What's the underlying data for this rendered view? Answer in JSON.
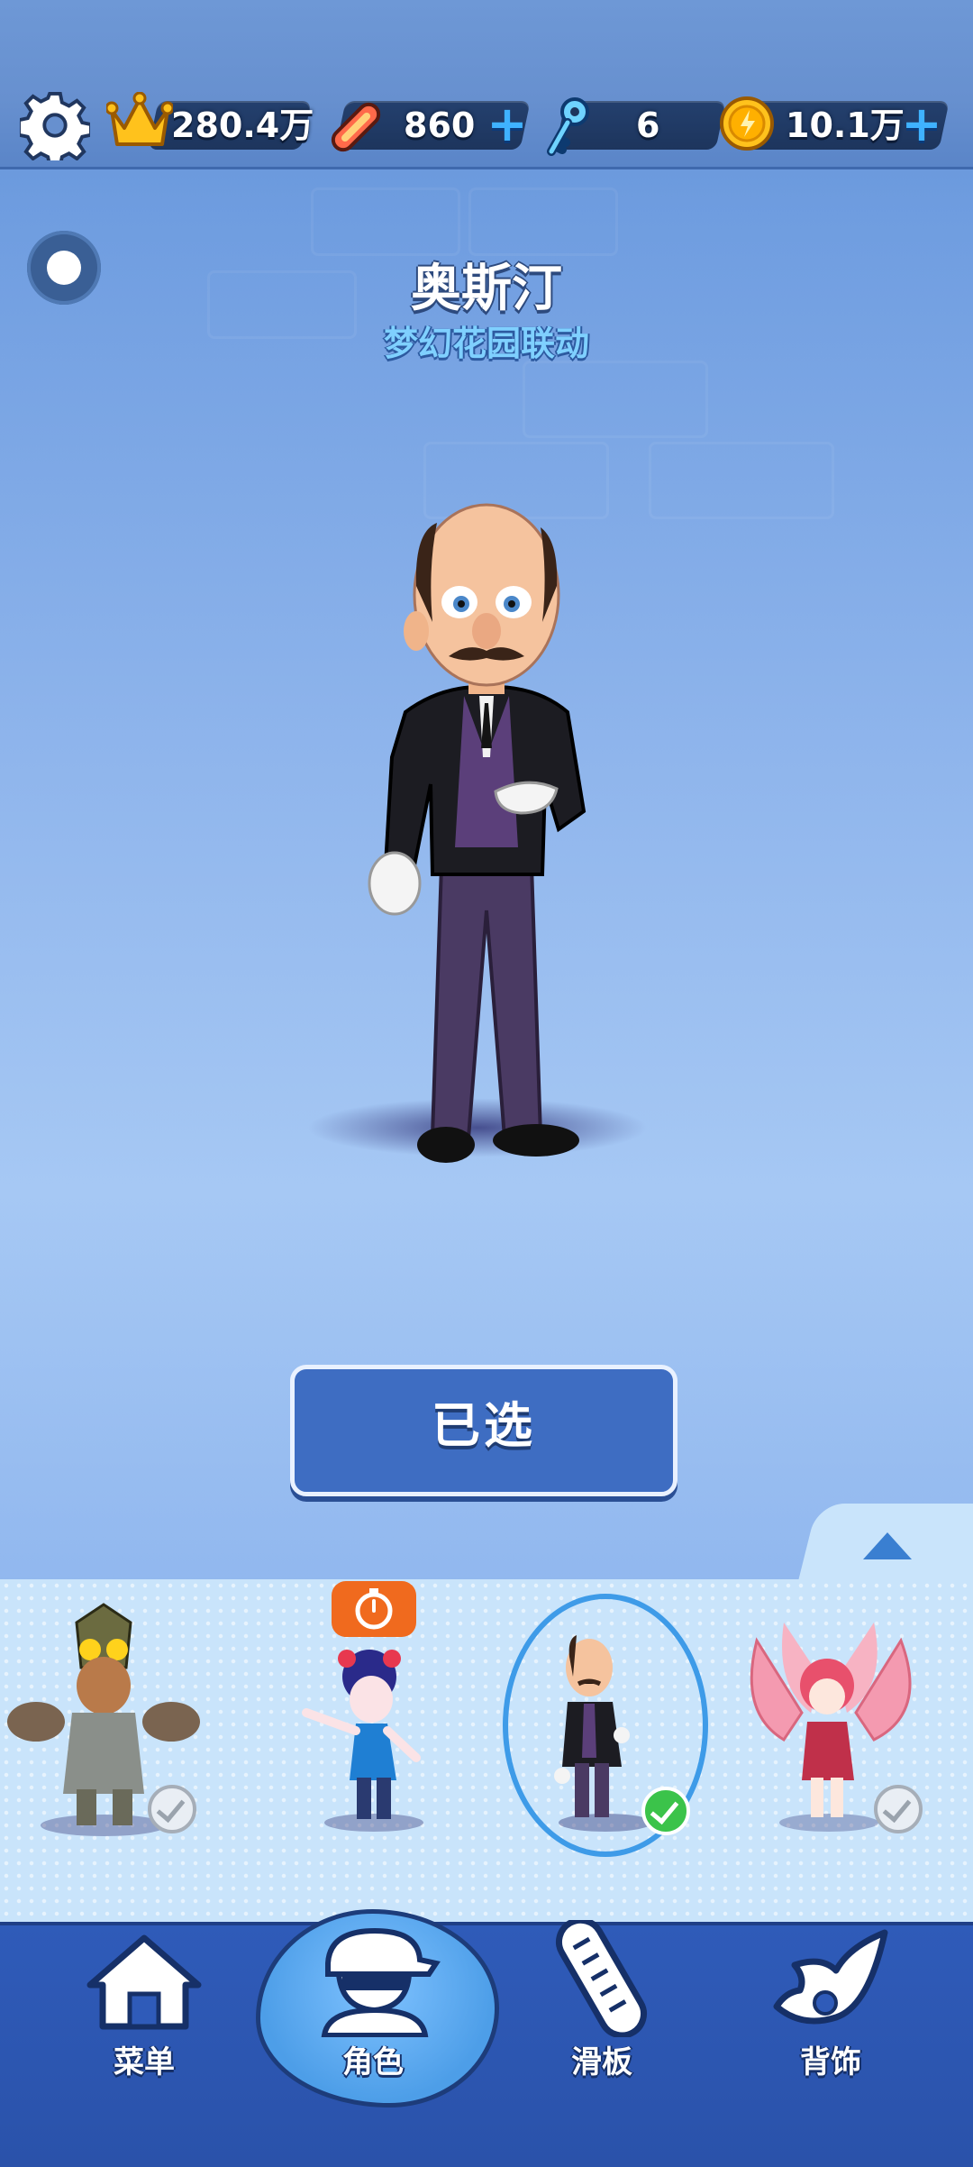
{
  "topbar": {
    "score": "280.4万",
    "hoverboards": "860",
    "keys": "6",
    "coins": "10.1万"
  },
  "character": {
    "name": "奥斯汀",
    "subtitle": "梦幻花园联动"
  },
  "select_button_label": "已选",
  "roster": {
    "items": [
      {
        "id": "roster-character-1",
        "owned": true,
        "selected": false
      },
      {
        "id": "roster-character-2",
        "owned": false,
        "selected": false,
        "timer": true
      },
      {
        "id": "roster-character-3",
        "owned": true,
        "selected": true
      },
      {
        "id": "roster-character-4",
        "owned": true,
        "selected": false
      }
    ]
  },
  "nav": {
    "menu": "菜单",
    "characters": "角色",
    "boards": "滑板",
    "accessories": "背饰",
    "active": "characters"
  },
  "colors": {
    "accent": "#3e6dc2",
    "plus": "#3fb2ff",
    "check": "#3bc34a",
    "timer": "#f06a1e"
  }
}
